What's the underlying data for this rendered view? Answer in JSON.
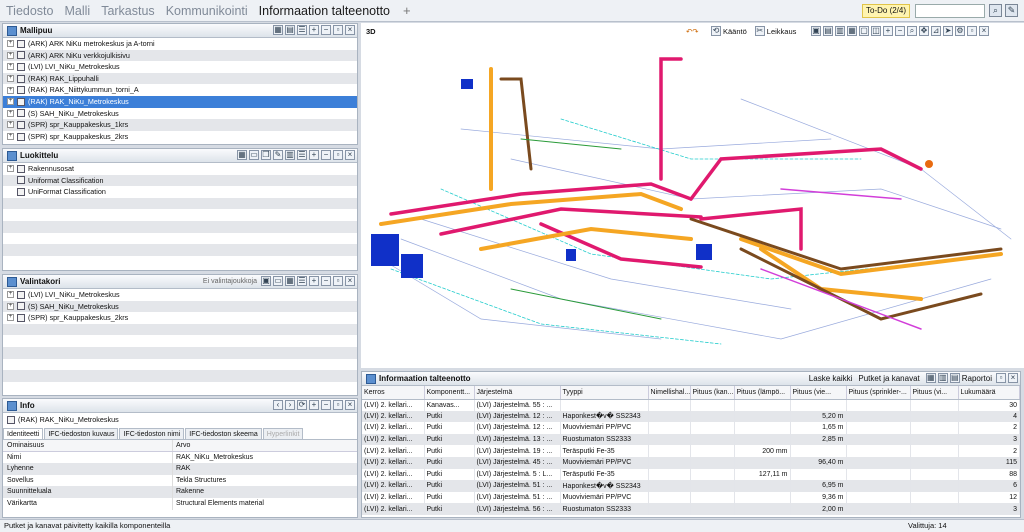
{
  "menu": {
    "items": [
      "Tiedosto",
      "Malli",
      "Tarkastus",
      "Kommunikointi",
      "Informaation talteenotto",
      "+"
    ],
    "active_index": 4
  },
  "toolbar_right": {
    "todo_label": "To-Do (2/4)",
    "search_value": ""
  },
  "model_tree": {
    "title": "Mallipuu",
    "items": [
      "(ARK) ARK NiKu metrokeskus ja A-torni",
      "(ARK) ARK NiKu verkkojulkisivu",
      "(LVI) LVI_NiKu_Metrokeskus",
      "(RAK) RAK_Lippuhalli",
      "(RAK) RAK_Niittykummun_torni_A",
      "(RAK) RAK_NiKu_Metrokeskus",
      "(S) SAH_NiKu_Metrokeskus",
      "(SPR) spr_Kauppakeskus_1krs",
      "(SPR) spr_Kauppakeskus_2krs"
    ],
    "selected_index": 5
  },
  "classification": {
    "title": "Luokittelu",
    "items": [
      "Rakennusosat",
      "Uniformat Classification",
      "UniFormat Classification"
    ]
  },
  "selection_basket": {
    "title": "Valintakori",
    "dropdown": "Ei valintajoukkoja",
    "items": [
      "(LVI) LVI_NiKu_Metrokeskus",
      "(S) SAH_NiKu_Metrokeskus",
      "(SPR) spr_Kauppakeskus_2krs"
    ]
  },
  "info": {
    "title": "Info",
    "subtitle": "(RAK) RAK_NiKu_Metrokeskus",
    "tabs": [
      "Identiteetti",
      "IFC-tiedoston kuvaus",
      "IFC-tiedoston nimi",
      "IFC-tiedoston skeema",
      "Hyperlinkit"
    ],
    "header": [
      "Ominaisuus",
      "Arvo"
    ],
    "rows": [
      [
        "Nimi",
        "RAK_NiKu_Metrokeskus"
      ],
      [
        "Lyhenne",
        "RAK"
      ],
      [
        "Sovellus",
        "Tekla Structures"
      ],
      [
        "Suunnitteluala",
        "Rakenne"
      ],
      [
        "Värikartta",
        "Structural Elements material"
      ]
    ]
  },
  "view3d": {
    "label": "3D",
    "tools": [
      "Kääntö",
      "Leikkaus"
    ]
  },
  "extraction": {
    "title": "Informaation talteenotto",
    "buttons": [
      "Laske kaikki",
      "Putket ja kanavat",
      "Raportoi"
    ],
    "columns": [
      "Kerros",
      "Komponentt...",
      "Järjestelmä",
      "Tyyppi",
      "Nimellishal...",
      "Pituus (kan...",
      "Pituus (lämpö...",
      "Pituus (vie...",
      "Pituus (sprinkler-...",
      "Pituus (vi...",
      "Lukumäärä"
    ],
    "rows": [
      [
        "(LVI) 2. kellari...",
        "Kanavas...",
        "(LVI) Järjestelmä. 55 : ...",
        "",
        "",
        "",
        "",
        "",
        "",
        "",
        "30"
      ],
      [
        "(LVI) 2. kellari...",
        "Putki",
        "(LVI) Järjestelmä. 12 : ...",
        "Haponkest�v� SS2343",
        "",
        "",
        "",
        "5,20 m",
        "",
        "",
        "4"
      ],
      [
        "(LVI) 2. kellari...",
        "Putki",
        "(LVI) Järjestelmä. 12 : ...",
        "Muoviviemäri PP/PVC",
        "",
        "",
        "",
        "1,65 m",
        "",
        "",
        "2"
      ],
      [
        "(LVI) 2. kellari...",
        "Putki",
        "(LVI) Järjestelmä. 13 : ...",
        "Ruostumaton SS2333",
        "",
        "",
        "",
        "2,85 m",
        "",
        "",
        "3"
      ],
      [
        "(LVI) 2. kellari...",
        "Putki",
        "(LVI) Järjestelmä. 19 : ...",
        "Teräsputki Fe-35",
        "",
        "",
        "200 mm",
        "",
        "",
        "",
        "2"
      ],
      [
        "(LVI) 2. kellari...",
        "Putki",
        "(LVI) Järjestelmä. 45 : ...",
        "Muoviviemäri PP/PVC",
        "",
        "",
        "",
        "96,40 m",
        "",
        "",
        "115"
      ],
      [
        "(LVI) 2. kellari...",
        "Putki",
        "(LVI) Järjestelmä. 5 : L...",
        "Teräsputki Fe-35",
        "",
        "",
        "127,11 m",
        "",
        "",
        "",
        "88"
      ],
      [
        "(LVI) 2. kellari...",
        "Putki",
        "(LVI) Järjestelmä. 51 : ...",
        "Haponkest�v� SS2343",
        "",
        "",
        "",
        "6,95 m",
        "",
        "",
        "6"
      ],
      [
        "(LVI) 2. kellari...",
        "Putki",
        "(LVI) Järjestelmä. 51 : ...",
        "Muoviviemäri PP/PVC",
        "",
        "",
        "",
        "9,36 m",
        "",
        "",
        "12"
      ],
      [
        "(LVI) 2. kellari...",
        "Putki",
        "(LVI) Järjestelmä. 56 : ...",
        "Ruostumaton SS2333",
        "",
        "",
        "",
        "2,00 m",
        "",
        "",
        "3"
      ]
    ]
  },
  "status": {
    "left": "Putket ja kanavat päivitetty kaikilla komponenteilla",
    "right": "Valittuja: 14"
  },
  "colors": {
    "selection": "#3c7fd8",
    "pipe_pink": "#e0196e",
    "pipe_orange": "#f5a623",
    "duct_blue": "#1030c8"
  }
}
